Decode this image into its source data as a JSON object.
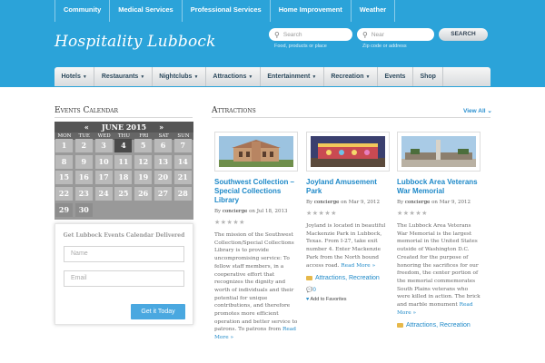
{
  "top_nav": [
    "Community",
    "Medical Services",
    "Professional Services",
    "Home Improvement",
    "Weather"
  ],
  "site_title": "Hospitality Lubbock",
  "search": {
    "query_placeholder": "Search",
    "query_hint": "Food, products or place",
    "near_placeholder": "Near",
    "near_hint": "Zip code or address",
    "button_label": "SEARCH"
  },
  "main_nav": [
    {
      "label": "Hotels",
      "dropdown": true
    },
    {
      "label": "Restaurants",
      "dropdown": true
    },
    {
      "label": "Nightclubs",
      "dropdown": true
    },
    {
      "label": "Attractions",
      "dropdown": true
    },
    {
      "label": "Entertainment",
      "dropdown": true
    },
    {
      "label": "Recreation",
      "dropdown": true
    },
    {
      "label": "Events",
      "dropdown": false
    },
    {
      "label": "Shop",
      "dropdown": false
    }
  ],
  "events_calendar": {
    "title": "Events Calendar",
    "prev": "«",
    "month": "JUNE 2015",
    "next": "»",
    "weekdays": [
      "MON",
      "TUE",
      "WED",
      "THU",
      "FRI",
      "SAT",
      "SUN"
    ],
    "days": [
      "1",
      "2",
      "3",
      "4",
      "5",
      "6",
      "7",
      "8",
      "9",
      "10",
      "11",
      "12",
      "13",
      "14",
      "15",
      "16",
      "17",
      "18",
      "19",
      "20",
      "21",
      "22",
      "23",
      "24",
      "25",
      "26",
      "27",
      "28",
      "29",
      "30"
    ],
    "current_day": "4"
  },
  "subscribe": {
    "title": "Get Lubbock Events Calendar Delivered",
    "name_placeholder": "Name",
    "email_placeholder": "Email",
    "button_label": "Get it Today"
  },
  "attractions": {
    "title": "Attractions",
    "view_all": "View All",
    "rating_stars": "★★★★★",
    "cards": [
      {
        "title": "Southwest Collection – Special Collections Library",
        "by": "By",
        "author": "concierge",
        "on": "on Jul 18, 2013",
        "description": "The mission of the Southwest Collection/Special Collections Library is to provide uncompromising service: To fellow staff members, in a cooperative effort that recognizes the dignity and worth of individuals and their potential for unique contributions, and therefore promotes more efficient operation and better service to patrons. To patrons from",
        "more": "Read More »"
      },
      {
        "title": "Joyland Amusement Park",
        "by": "By",
        "author": "concierge",
        "on": "on Mar 9, 2012",
        "description": "Joyland is located in beautiful Mackenzie Park in Lubbock, Texas. From I-27, take exit number 4. Enter Mackenzie Park from the North bound access road.",
        "more": "Read More »",
        "tags": "Attractions, Recreation",
        "comments": "0",
        "favorite": "Add to Favorites"
      },
      {
        "title": "Lubbock Area Veterans War Memorial",
        "by": "By",
        "author": "concierge",
        "on": "on Mar 9, 2012",
        "description": "The Lubbock Area Veterans War Memorial is the largest memorial in the United States outside of Washington D.C. Created for the purpose of honoring the sacrifices for our freedom, the center portion of the memorial commemorates South Plains veterans who were killed in action. The brick and marble monument",
        "more": "Read More »",
        "tags": "Attractions, Recreation"
      }
    ]
  }
}
